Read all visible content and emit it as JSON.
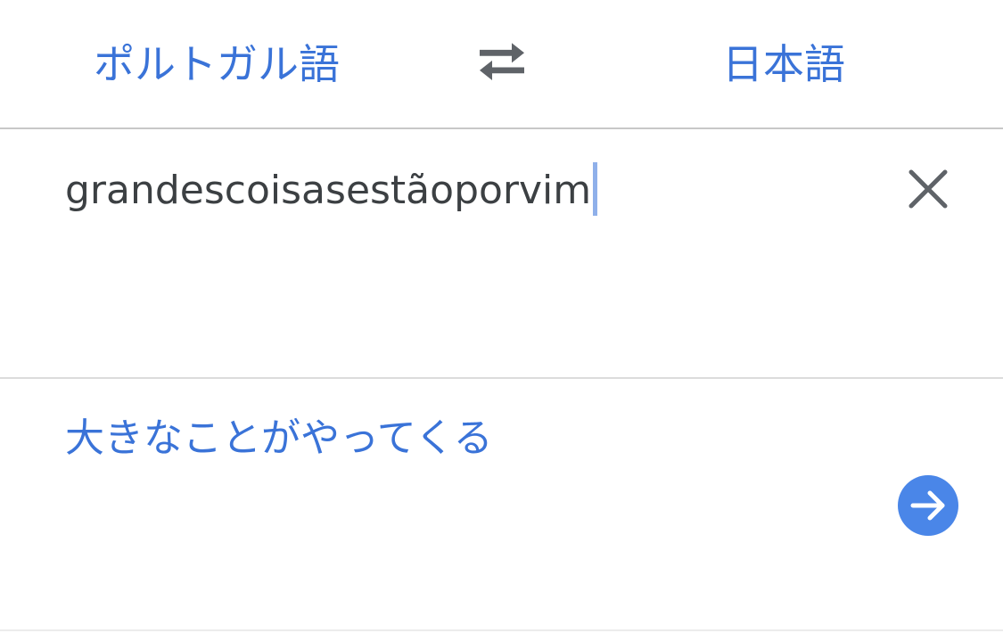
{
  "language_bar": {
    "source_language": "ポルトガル語",
    "target_language": "日本語",
    "swap_icon": "swap-horizontal-icon"
  },
  "input": {
    "value": "grandescoisasestãoporvim",
    "clear_icon": "close-icon"
  },
  "output": {
    "translation": "大きなことがやってくる",
    "go_icon": "arrow-right-circle-icon"
  },
  "colors": {
    "accent": "#3a73d8",
    "button": "#4a86e8",
    "input_text": "#3c4043",
    "icon": "#5f6368",
    "caret": "#8fb0ea"
  }
}
